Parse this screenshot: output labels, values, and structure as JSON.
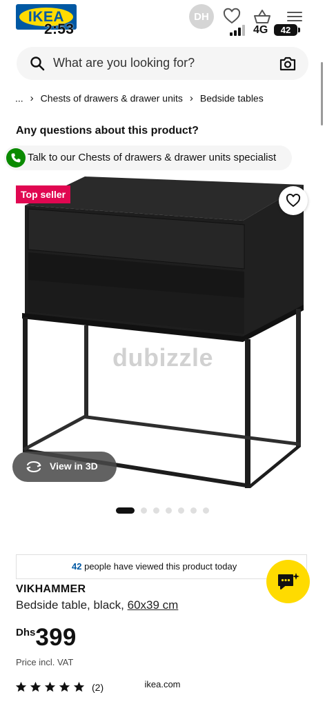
{
  "status_bar": {
    "time": "2:53",
    "network": "4G",
    "battery": "42"
  },
  "header": {
    "logo_text": "IKEA",
    "avatar_initials": "DH"
  },
  "search": {
    "placeholder": "What are you looking for?"
  },
  "breadcrumb": {
    "items": [
      "...",
      "Chests of drawers & drawer units",
      "Bedside tables"
    ]
  },
  "questions": {
    "heading": "Any questions about this product?",
    "chat_label": "Talk to our Chests of drawers & drawer units specialist"
  },
  "gallery": {
    "badge": "Top seller",
    "watermark": "dubizzle",
    "view_3d_label": "View in 3D",
    "slide_count": 7,
    "active_slide": 1
  },
  "viewers": {
    "count": "42",
    "text": "people have viewed this product today"
  },
  "product": {
    "name": "VIKHAMMER",
    "description": "Bedside table, black,",
    "dimensions": "60x39 cm",
    "currency": "Dhs",
    "price": "399",
    "vat_note": "Price incl. VAT",
    "rating_stars": 5,
    "review_count": "(2)"
  },
  "footer": {
    "domain": "ikea.com"
  },
  "colors": {
    "ikea_blue": "#0058a3",
    "ikea_yellow": "#ffdb00",
    "badge_red": "#e00751",
    "chat_green": "#0a8a00",
    "furniture_black": "#1e1e1e"
  }
}
